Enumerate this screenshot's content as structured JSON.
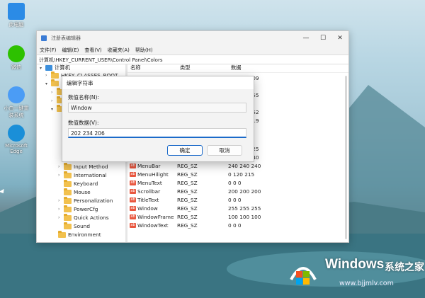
{
  "desktop": {
    "icons": [
      {
        "label": "此电脑",
        "icon": "computer-icon",
        "color": "#2b8be6"
      },
      {
        "label": "微信",
        "icon": "wechat-icon",
        "color": "#2dc100"
      },
      {
        "label": "小白一键重装系统",
        "icon": "reinstall-icon",
        "color": "#4b9cf5"
      },
      {
        "label": "Microsoft Edge",
        "icon": "edge-icon",
        "color": "#1a8fd8"
      }
    ]
  },
  "regedit": {
    "title": "注册表编辑器",
    "controls": [
      "—",
      "☐",
      "✕"
    ],
    "menu": [
      "文件(F)",
      "编辑(E)",
      "查看(V)",
      "收藏夹(A)",
      "帮助(H)"
    ],
    "address": "计算机\\HKEY_CURRENT_USER\\Control Panel\\Colors",
    "tree": {
      "root": "计算机",
      "hidden_node": "HKEY_CLASSES_ROOT",
      "items": [
        "Input Method",
        "International",
        "Keyboard",
        "Mouse",
        "Personalization",
        "PowerCfg",
        "Quick Actions",
        "Sound",
        "Environment"
      ]
    },
    "columns": [
      "名称",
      "类型",
      "数据"
    ],
    "top_values": [
      "09 109",
      "215",
      "55 255",
      "204",
      "57 252",
      "55 219",
      "",
      "",
      "55 225",
      "40 240"
    ],
    "rows": [
      {
        "name": "MenuBar",
        "type": "REG_SZ",
        "data": "240 240 240"
      },
      {
        "name": "MenuHilight",
        "type": "REG_SZ",
        "data": "0 120 215"
      },
      {
        "name": "MenuText",
        "type": "REG_SZ",
        "data": "0 0 0"
      },
      {
        "name": "Scrollbar",
        "type": "REG_SZ",
        "data": "200 200 200"
      },
      {
        "name": "TitleText",
        "type": "REG_SZ",
        "data": "0 0 0"
      },
      {
        "name": "Window",
        "type": "REG_SZ",
        "data": "255 255 255"
      },
      {
        "name": "WindowFrame",
        "type": "REG_SZ",
        "data": "100 100 100"
      },
      {
        "name": "WindowText",
        "type": "REG_SZ",
        "data": "0 0 0"
      }
    ]
  },
  "dialog": {
    "title": "编辑字符串",
    "name_label": "数值名称(N):",
    "name_value": "Window",
    "data_label": "数值数据(V):",
    "data_value": "202 234 206",
    "ok": "确定",
    "cancel": "取消"
  },
  "watermark": {
    "brand": "Windows",
    "brand_cn": "系统之家",
    "url": "www.bjjmlv.com"
  }
}
